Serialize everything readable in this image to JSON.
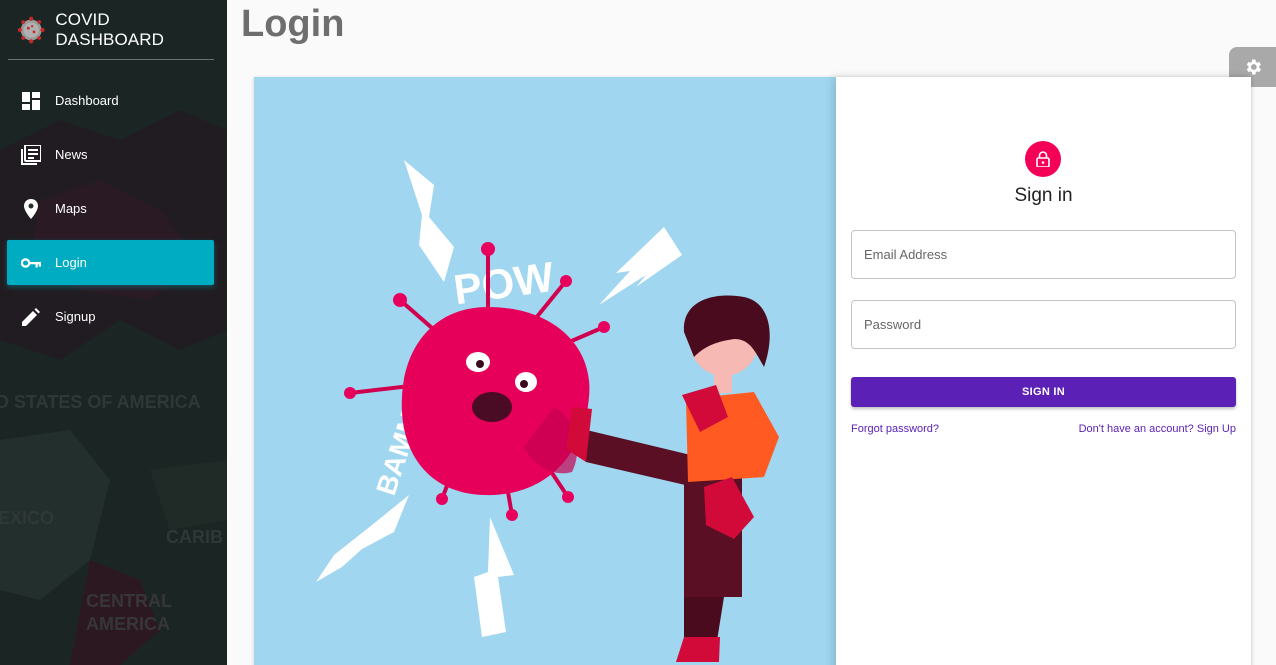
{
  "app": {
    "title": "COVID DASHBOARD"
  },
  "sidebar": {
    "items": [
      {
        "label": "Dashboard",
        "icon": "dashboard-icon",
        "active": false
      },
      {
        "label": "News",
        "icon": "news-icon",
        "active": false
      },
      {
        "label": "Maps",
        "icon": "map-pin-icon",
        "active": false
      },
      {
        "label": "Login",
        "icon": "key-icon",
        "active": true
      },
      {
        "label": "Signup",
        "icon": "pencil-icon",
        "active": false
      }
    ],
    "map_labels": [
      "D STATES OF AMERICA",
      "EXICO",
      "CARIB",
      "CENTRAL",
      "AMERICA"
    ]
  },
  "header": {
    "title": "Login"
  },
  "illustration": {
    "texts": [
      "POW",
      "BAMMMM!!"
    ]
  },
  "form": {
    "title": "Sign in",
    "email_placeholder": "Email Address",
    "password_placeholder": "Password",
    "submit_label": "SIGN IN",
    "forgot_label": "Forgot password?",
    "signup_label": "Don't have an account? Sign Up"
  },
  "colors": {
    "accent_active": "#00acc1",
    "primary_button": "#5b21b6",
    "lock_avatar": "#f50057",
    "illustration_bg": "#a0d6f0"
  }
}
